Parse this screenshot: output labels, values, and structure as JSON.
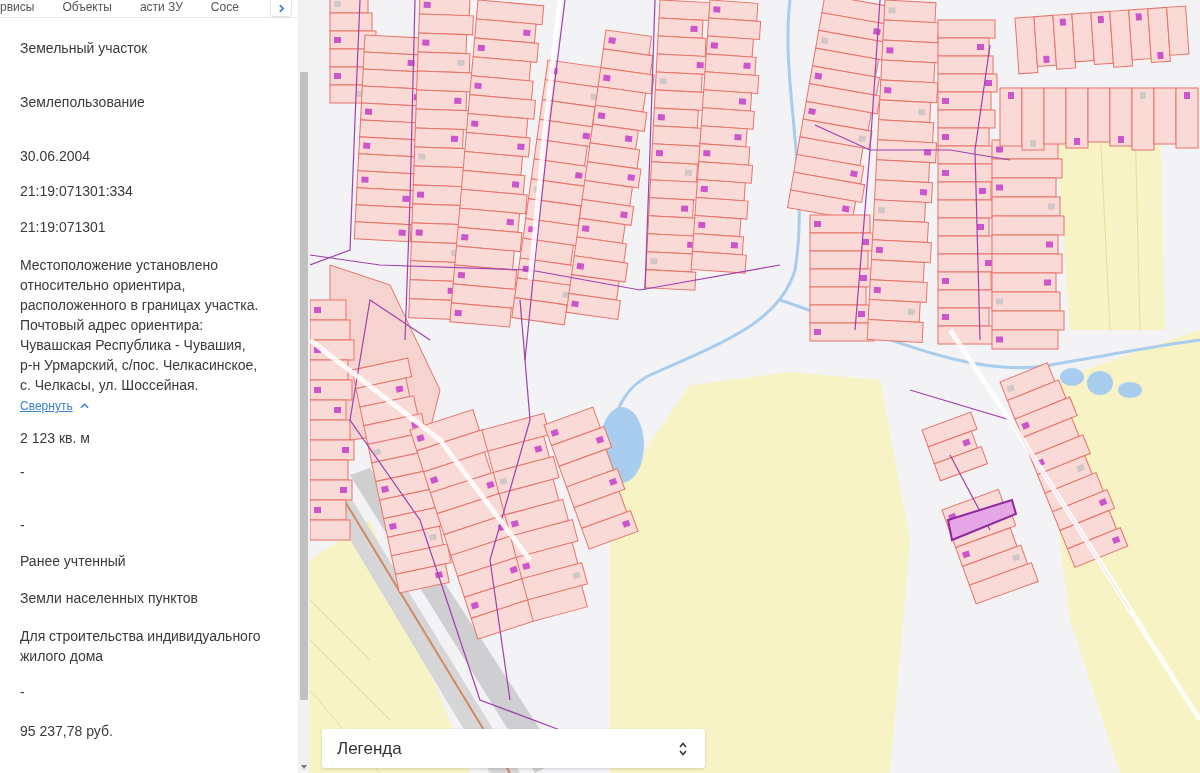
{
  "tabs": [
    {
      "label": "рвисы",
      "selected": false
    },
    {
      "label": "Объекты",
      "selected": false
    },
    {
      "label": "асти ЗУ",
      "selected": false
    },
    {
      "label": "Сосе",
      "selected": false
    }
  ],
  "details": [
    {
      "value": "Земельный участок"
    },
    {
      "value": "Землепользование"
    },
    {
      "value": "30.06.2004"
    },
    {
      "value": "21:19:071301:334"
    },
    {
      "value": "21:19:071301"
    },
    {
      "value": "Местоположение установлено\nотносительно ориентира,\nрасположенного в границах участка.\nПочтовый адрес ориентира:\nЧувашская Республика - Чувашия,\nр-н Урмарский, с/пос. Челкасинское,\nс. Челкасы, ул. Шоссейная.",
      "toggle": {
        "label": "Свернуть",
        "expanded": true
      }
    },
    {
      "value": "2 123 кв. м"
    },
    {
      "value": "-"
    },
    {
      "value": "-"
    },
    {
      "value": "Ранее учтенный"
    },
    {
      "value": "Земли населенных пунктов"
    },
    {
      "value": "Для строительства индивидуального\nжилого дома"
    },
    {
      "value": "-"
    },
    {
      "value": "95 237,78 руб."
    }
  ],
  "legend": {
    "label": "Легенда"
  }
}
